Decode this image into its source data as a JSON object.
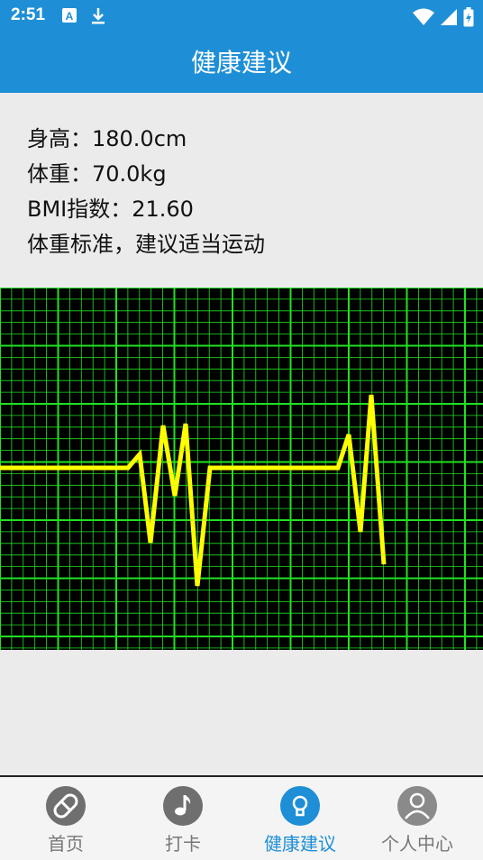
{
  "status_bar": {
    "time": "2:51",
    "icons": [
      "keyboard-a-icon",
      "download-icon",
      "wifi-icon",
      "signal-icon",
      "battery-icon"
    ]
  },
  "header": {
    "title": "健康建议"
  },
  "info": {
    "height_line": "身高：180.0cm",
    "weight_line": "体重：70.0kg",
    "bmi_line": "BMI指数：21.60",
    "advice_line": "体重标准，建议适当运动"
  },
  "ecg": {
    "background": "#000000",
    "grid_color": "#22e022",
    "trace_color": "#ffff00"
  },
  "nav": {
    "items": [
      {
        "label": "首页",
        "icon": "pill-icon",
        "active": false
      },
      {
        "label": "打卡",
        "icon": "music-note-icon",
        "active": false
      },
      {
        "label": "健康建议",
        "icon": "lightbulb-icon",
        "active": true
      },
      {
        "label": "个人中心",
        "icon": "person-icon",
        "active": false
      }
    ],
    "active_color": "#1e8fd7",
    "inactive_color": "#777777"
  }
}
